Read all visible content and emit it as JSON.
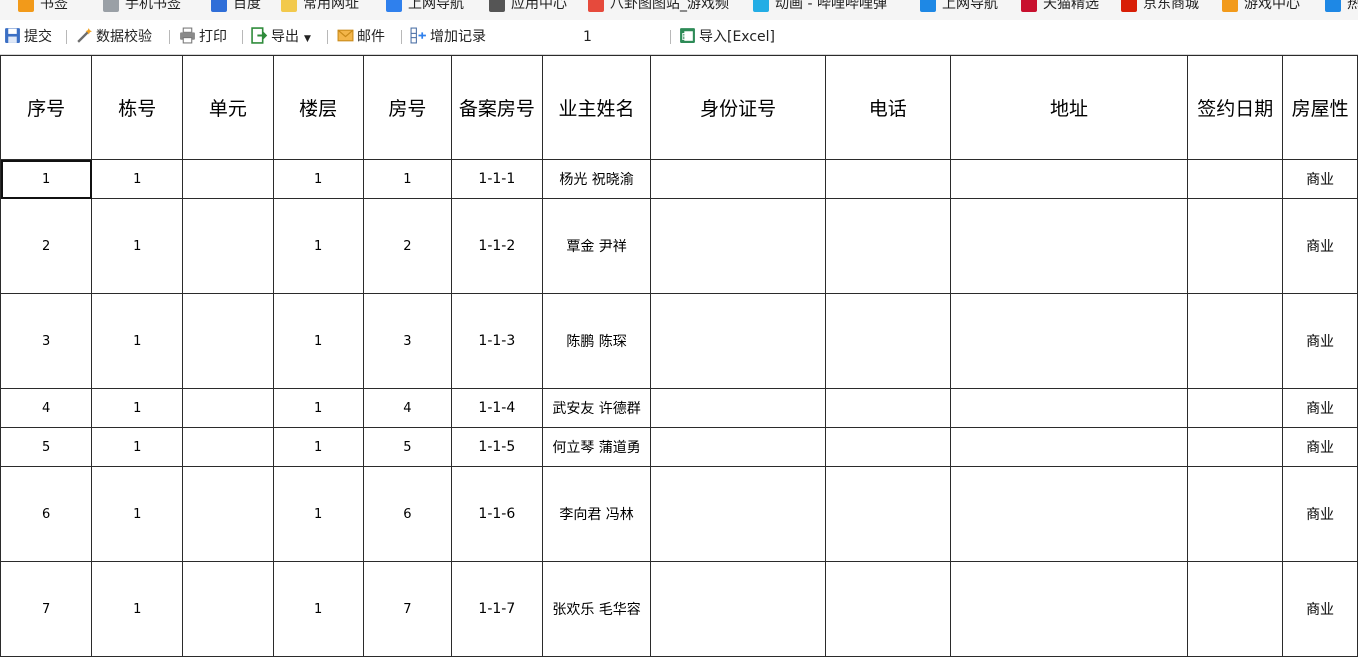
{
  "bookmarks": [
    {
      "label": "书签",
      "icon": "star-icon",
      "color": "#f29a1a"
    },
    {
      "label": "手机书签",
      "icon": "phone-icon",
      "color": "#9aa0a6"
    },
    {
      "label": "百度",
      "icon": "paw-icon",
      "color": "#2f6ed8"
    },
    {
      "label": "常用网址",
      "icon": "folder-icon",
      "color": "#f2c94c"
    },
    {
      "label": "上网导航",
      "icon": "compass-icon",
      "color": "#2f80ed"
    },
    {
      "label": "应用中心",
      "icon": "globe-icon",
      "color": "#555555"
    },
    {
      "label": "八卦图图站_游戏频",
      "icon": "chrome-icon",
      "color": "#e64a3c"
    },
    {
      "label": "动画 - 哔哩哔哩弹",
      "icon": "tv-icon",
      "color": "#23ade5"
    },
    {
      "label": "上网导航",
      "icon": "ie-icon",
      "color": "#1e88e5"
    },
    {
      "label": "天猫精选",
      "icon": "tmall-icon",
      "color": "#c8102e"
    },
    {
      "label": "京东商城",
      "icon": "jd-icon",
      "color": "#d81e06"
    },
    {
      "label": "游戏中心",
      "icon": "gamepad-icon",
      "color": "#f29a1a"
    },
    {
      "label": "热",
      "icon": "arrow-icon",
      "color": "#1e88e5"
    }
  ],
  "toolbar": {
    "submit": "提交",
    "validate": "数据校验",
    "print": "打印",
    "export": "导出",
    "mail": "邮件",
    "add_record": "增加记录",
    "page_number": "1",
    "import": "导入[Excel]"
  },
  "sheet": {
    "headers": [
      "序号",
      "栋号",
      "单元",
      "楼层",
      "房号",
      "备案房号",
      "业主姓名",
      "身份证号",
      "电话",
      "地址",
      "签约日期",
      "房屋性"
    ],
    "rows": [
      [
        "1",
        "1",
        "",
        "1",
        "1",
        "1-1-1",
        "杨光 祝晓渝",
        "",
        "",
        "",
        "",
        "商业"
      ],
      [
        "2",
        "1",
        "",
        "1",
        "2",
        "1-1-2",
        "覃金 尹祥",
        "",
        "",
        "",
        "",
        "商业"
      ],
      [
        "3",
        "1",
        "",
        "1",
        "3",
        "1-1-3",
        "陈鹏 陈琛",
        "",
        "",
        "",
        "",
        "商业"
      ],
      [
        "4",
        "1",
        "",
        "1",
        "4",
        "1-1-4",
        "武安友 许德群",
        "",
        "",
        "",
        "",
        "商业"
      ],
      [
        "5",
        "1",
        "",
        "1",
        "5",
        "1-1-5",
        "何立琴 蒲道勇",
        "",
        "",
        "",
        "",
        "商业"
      ],
      [
        "6",
        "1",
        "",
        "1",
        "6",
        "1-1-6",
        "李向君 冯林",
        "",
        "",
        "",
        "",
        "商业"
      ],
      [
        "7",
        "1",
        "",
        "1",
        "7",
        "1-1-7",
        "张欢乐 毛华容",
        "",
        "",
        "",
        "",
        "商业"
      ]
    ]
  }
}
